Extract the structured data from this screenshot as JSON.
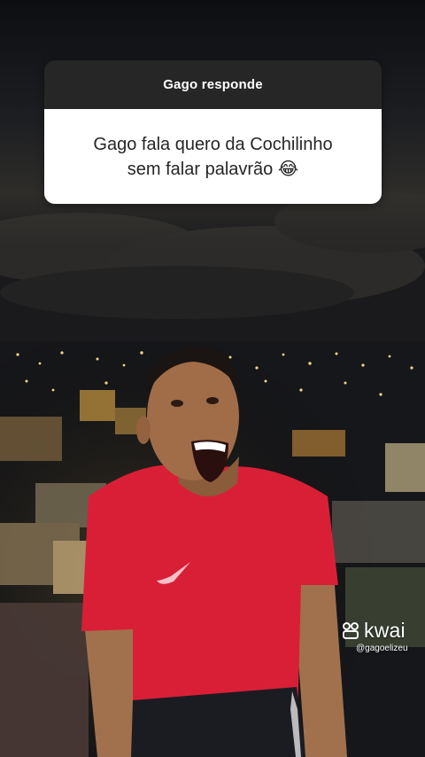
{
  "question_box": {
    "header": "Gago responde",
    "text": "Gago fala quero da Cochilinho sem falar palavrão",
    "emoji": "😂"
  },
  "watermark": {
    "brand": "kwai",
    "handle": "@gagoelizeu"
  },
  "colors": {
    "header_bg": "#262626",
    "body_bg": "#ffffff",
    "shirt": "#d91f36"
  },
  "icons": [
    "kwai-logo-icon",
    "nike-swoosh-icon"
  ]
}
